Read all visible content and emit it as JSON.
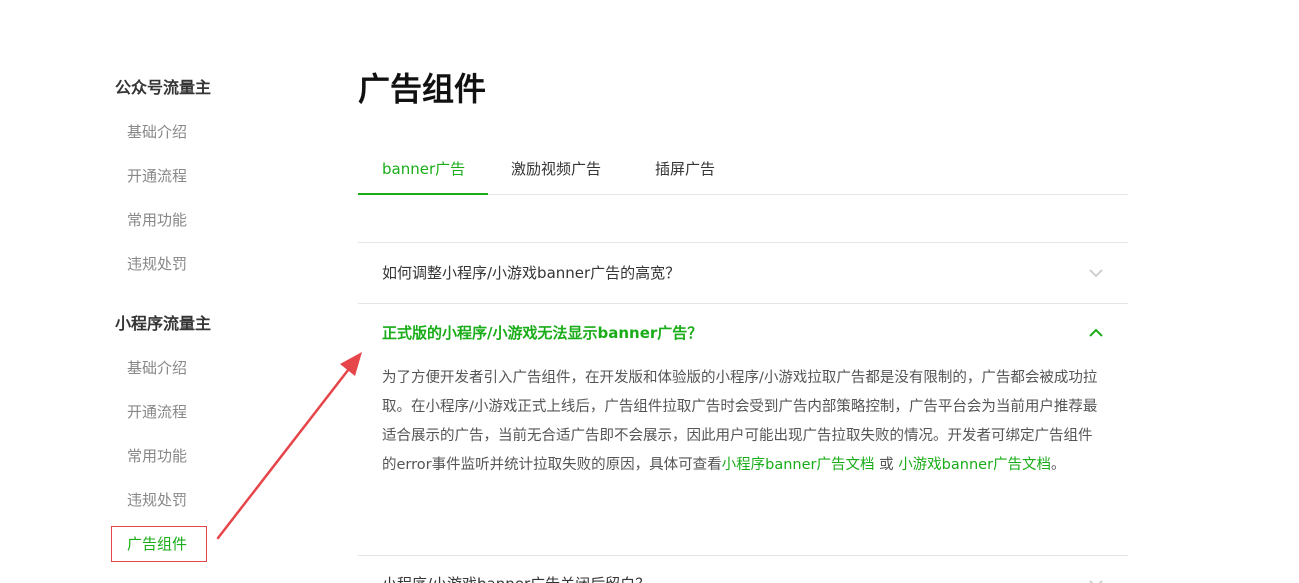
{
  "sidebar": {
    "groups": [
      {
        "title": "公众号流量主",
        "items": [
          "基础介绍",
          "开通流程",
          "常用功能",
          "违规处罚"
        ]
      },
      {
        "title": "小程序流量主",
        "items": [
          "基础介绍",
          "开通流程",
          "常用功能",
          "违规处罚",
          "广告组件"
        ]
      }
    ],
    "active_item": "广告组件"
  },
  "main": {
    "title": "广告组件",
    "tabs": [
      "banner广告",
      "激励视频广告",
      "插屏广告"
    ],
    "active_tab": "banner广告",
    "faq": [
      {
        "question": "如何调整小程序/小游戏banner广告的高宽？",
        "expanded": false
      },
      {
        "question": "正式版的小程序/小游戏无法显示banner广告？",
        "expanded": true,
        "answer_text": "为了方便开发者引入广告组件，在开发版和体验版的小程序/小游戏拉取广告都是没有限制的，广告都会被成功拉取。在小程序/小游戏正式上线后，广告组件拉取广告时会受到广告内部策略控制，广告平台会为当前用户推荐最适合展示的广告，当前无合适广告即不会展示，因此用户可能出现广告拉取失败的情况。开发者可绑定广告组件的error事件监听并统计拉取失败的原因，具体可查看",
        "link1": "小程序banner广告文档",
        "connector": " 或 ",
        "link2": "小游戏banner广告文档",
        "end": "。"
      },
      {
        "question": "小程序/小游戏banner广告关闭后留白？",
        "expanded": false
      }
    ]
  },
  "colors": {
    "accent": "#1aad19",
    "annotation": "#e6454a"
  }
}
